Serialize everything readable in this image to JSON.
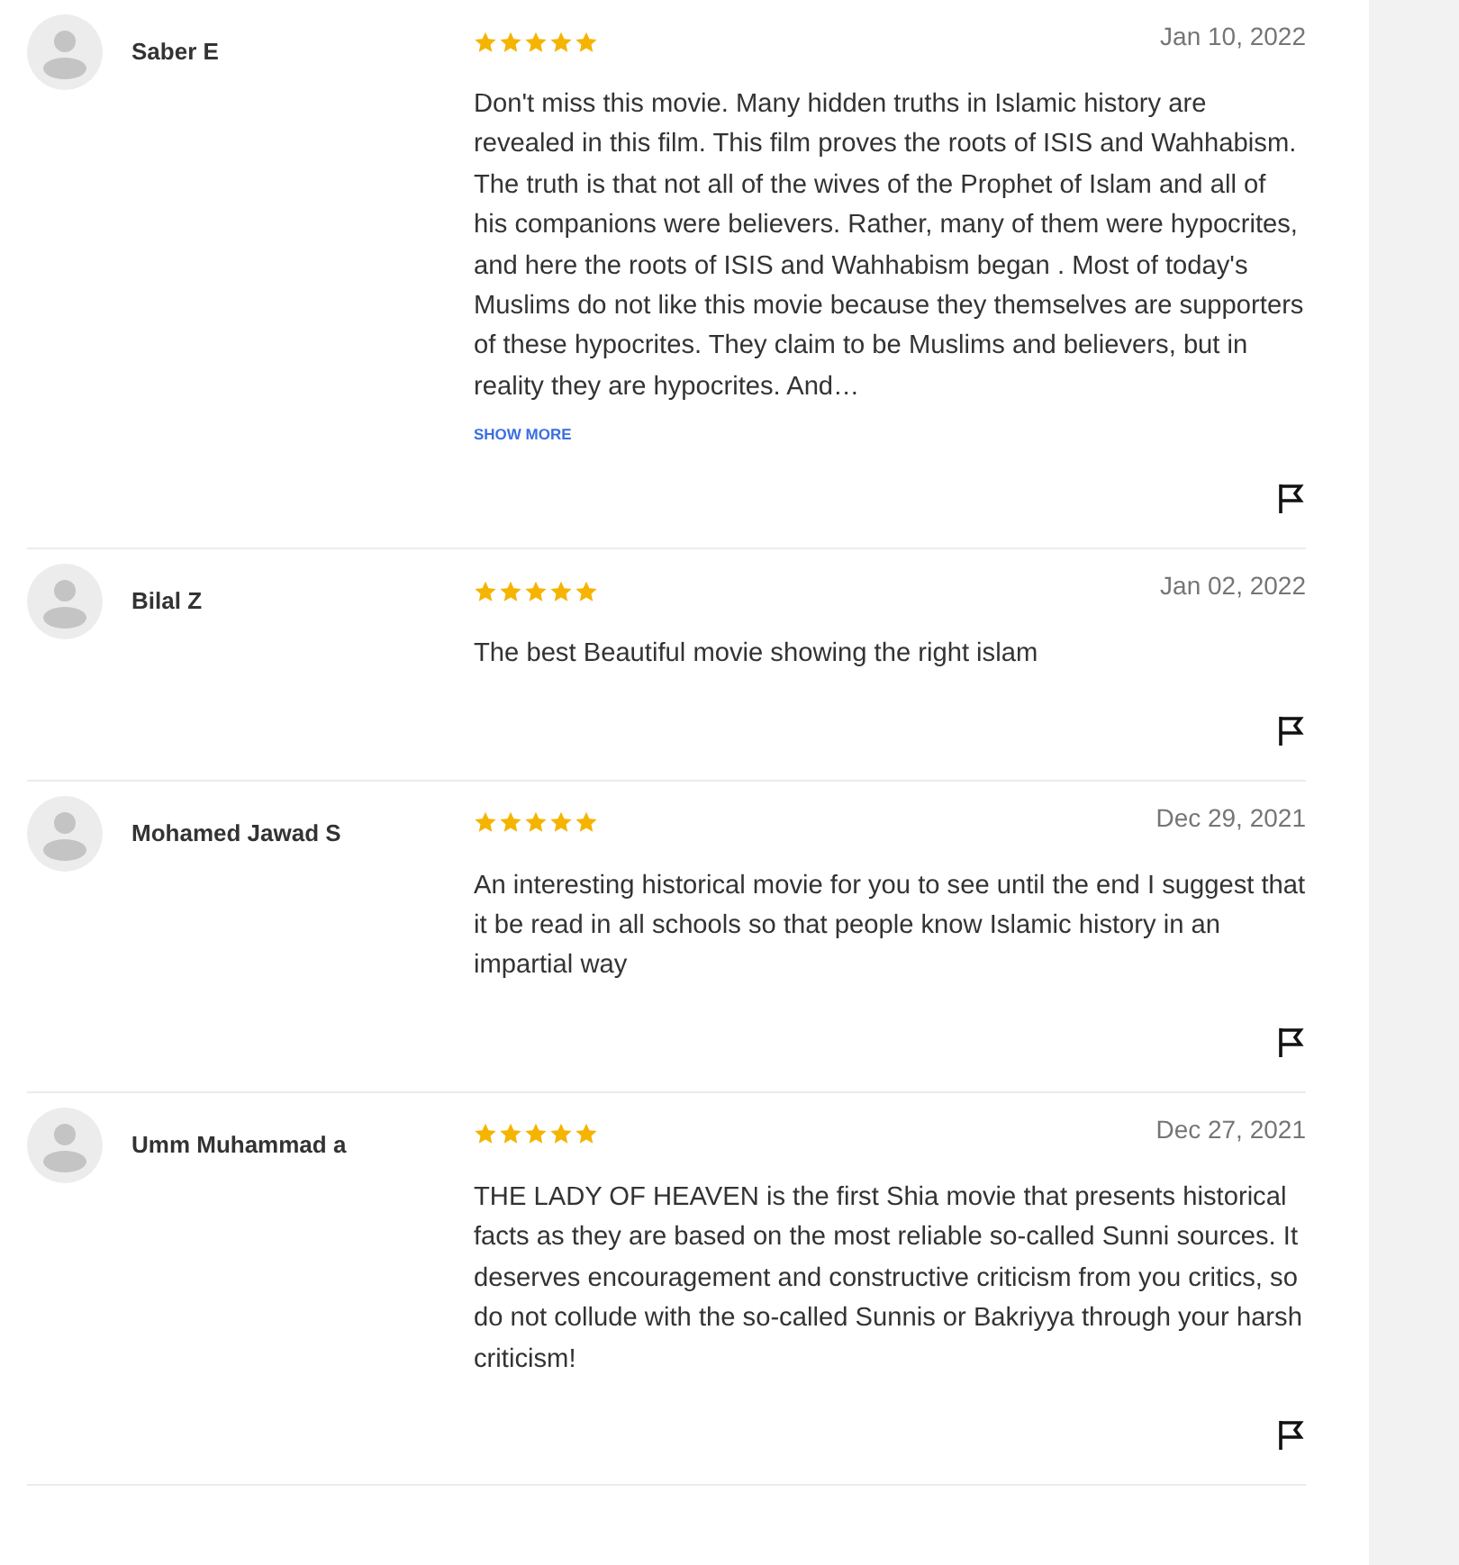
{
  "reviews": [
    {
      "name": "Saber E",
      "stars": 5,
      "date": "Jan 10, 2022",
      "text": "Don't miss this movie. Many hidden truths in Islamic history are revealed in this film. This film proves the roots of ISIS and Wahhabism. The truth is that not all of the wives of the Prophet of Islam and all of his companions were believers. Rather, many of them were hypocrites, and here the roots of ISIS and Wahhabism began . Most of today's Muslims do not like this movie because they themselves are supporters of these hypocrites. They claim to be Muslims and believers, but in reality they are hypocrites. And…",
      "show_more": "SHOW MORE"
    },
    {
      "name": "Bilal Z",
      "stars": 5,
      "date": "Jan 02, 2022",
      "text": "The best Beautiful movie showing the right islam"
    },
    {
      "name": "Mohamed Jawad S",
      "stars": 5,
      "date": "Dec 29, 2021",
      "text": "An interesting historical movie for you to see until the end I suggest that it be read in all schools so that people know Islamic history in an impartial way"
    },
    {
      "name": "Umm Muhammad a",
      "stars": 5,
      "date": "Dec 27, 2021",
      "text": "THE LADY OF HEAVEN is the first Shia movie that presents historical facts as they are based on the most reliable so-called Sunni sources. It deserves encouragement and constructive criticism from you critics, so do not collude with the so-called Sunnis or Bakriyya through your harsh criticism!"
    }
  ]
}
